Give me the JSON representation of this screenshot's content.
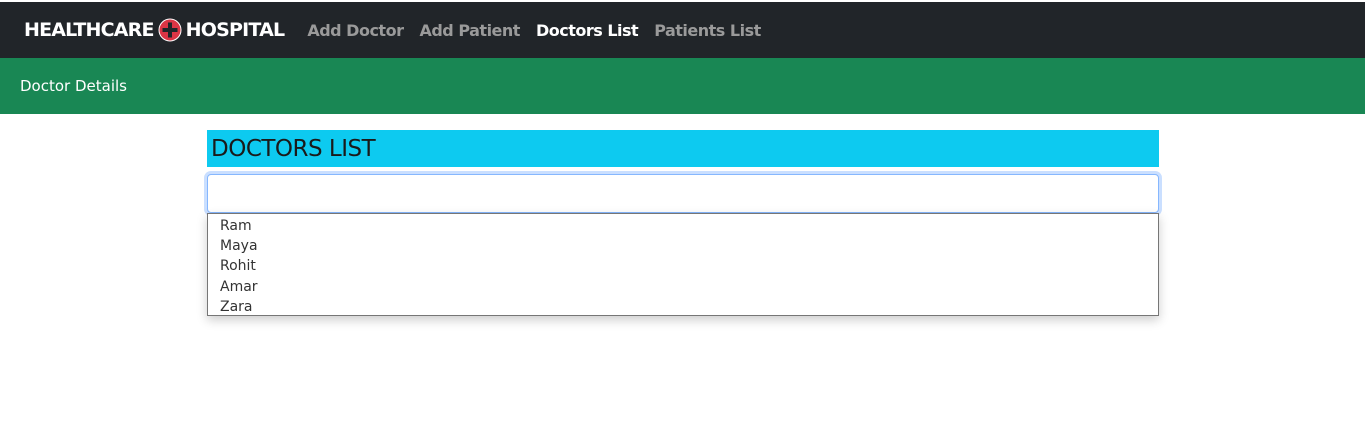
{
  "navbar": {
    "brand_left": "HEALTHCARE",
    "brand_right": "HOSPITAL",
    "links": [
      {
        "label": "Add Doctor"
      },
      {
        "label": "Add Patient"
      },
      {
        "label": "Doctors List"
      },
      {
        "label": "Patients List"
      }
    ],
    "active_link": "Doctors List"
  },
  "subbar": {
    "title": "Doctor Details"
  },
  "main": {
    "heading": "DOCTORS LIST",
    "search": {
      "value": "",
      "placeholder": ""
    },
    "options": [
      "Ram",
      "Maya",
      "Rohit",
      "Amar",
      "Zara"
    ]
  },
  "colors": {
    "navbar_bg": "#212529",
    "subbar_bg": "#198754",
    "heading_bg": "#0dcaf0",
    "brand_cross": "#dc3545"
  },
  "icons": {
    "brand": "medical-cross-icon"
  }
}
